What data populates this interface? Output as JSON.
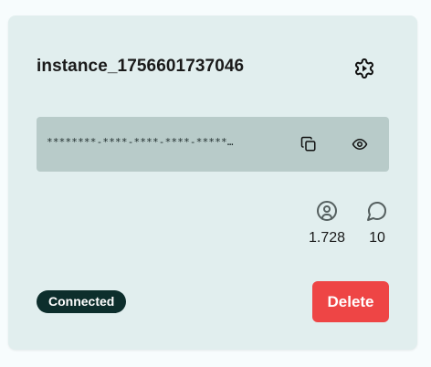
{
  "instance": {
    "name": "instance_1756601737046",
    "token_masked": "********-****-****-****-*****…"
  },
  "icons": {
    "settings": "gear-icon",
    "copy": "copy-icon",
    "visibility": "eye-icon",
    "users": "user-circle-icon",
    "messages": "message-circle-icon"
  },
  "stats": {
    "contacts": "1.728",
    "messages": "10"
  },
  "status": {
    "label": "Connected",
    "color": "#0d2e2c"
  },
  "actions": {
    "delete_label": "Delete",
    "delete_color": "#ee4545"
  },
  "theme": {
    "card_bg": "#e1eeee",
    "token_bg": "#b8cbc9"
  }
}
